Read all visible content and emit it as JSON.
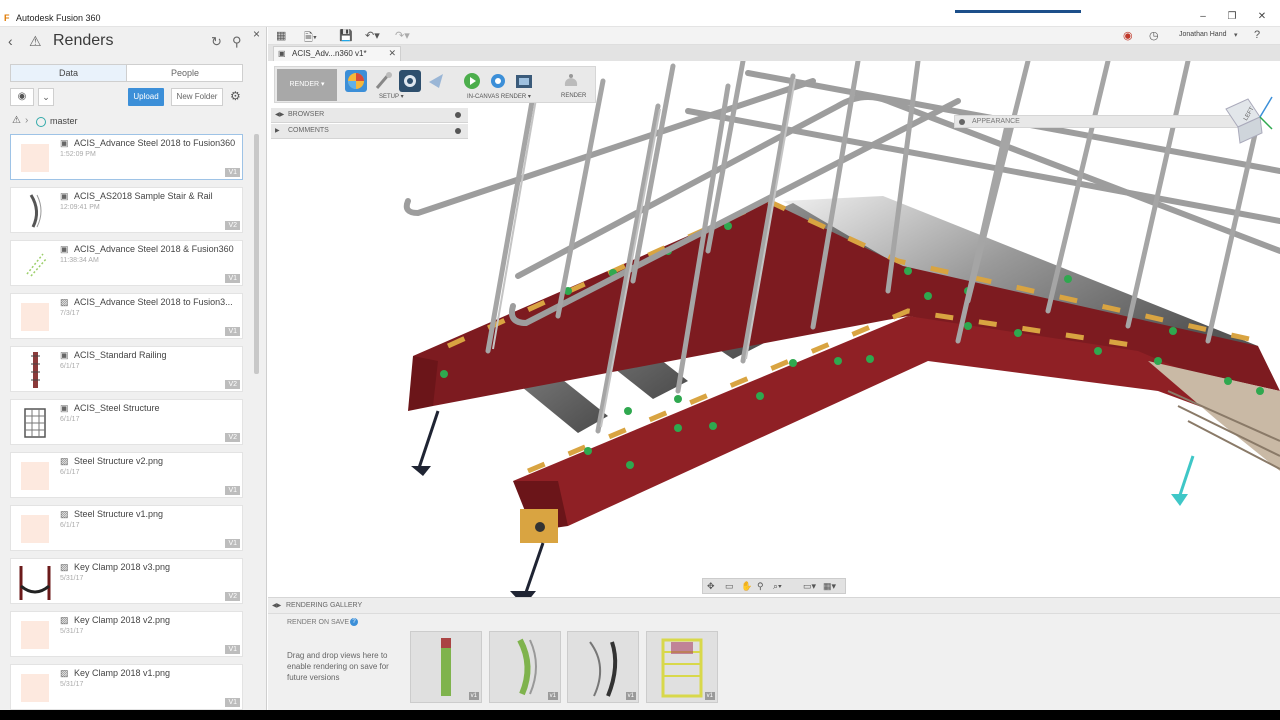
{
  "window": {
    "title": "Autodesk Fusion 360"
  },
  "left_panel": {
    "title": "Renders",
    "tabs": [
      "Data",
      "People"
    ],
    "upload_label": "Upload",
    "new_folder_label": "New Folder",
    "breadcrumb_label": "master",
    "files": [
      {
        "name": "ACIS_Advance Steel 2018 to Fusion360",
        "date": "1:52:09 PM",
        "version": "V1",
        "kind": "design"
      },
      {
        "name": "ACIS_AS2018 Sample Stair & Rail",
        "date": "12:09:41 PM",
        "version": "V2",
        "kind": "design"
      },
      {
        "name": "ACIS_Advance Steel 2018 & Fusion360",
        "date": "11:38:34 AM",
        "version": "V1",
        "kind": "design"
      },
      {
        "name": "ACIS_Advance Steel 2018 to Fusion3...",
        "date": "7/3/17",
        "version": "V1",
        "kind": "image"
      },
      {
        "name": "ACIS_Standard Railing",
        "date": "6/1/17",
        "version": "V2",
        "kind": "design"
      },
      {
        "name": "ACIS_Steel Structure",
        "date": "6/1/17",
        "version": "V2",
        "kind": "design"
      },
      {
        "name": "Steel Structure v2.png",
        "date": "6/1/17",
        "version": "V1",
        "kind": "image"
      },
      {
        "name": "Steel Structure v1.png",
        "date": "6/1/17",
        "version": "V1",
        "kind": "image"
      },
      {
        "name": "Key Clamp 2018 v3.png",
        "date": "5/31/17",
        "version": "V2",
        "kind": "image"
      },
      {
        "name": "Key Clamp 2018 v2.png",
        "date": "5/31/17",
        "version": "V1",
        "kind": "image"
      },
      {
        "name": "Key Clamp 2018 v1.png",
        "date": "5/31/17",
        "version": "V1",
        "kind": "image"
      }
    ]
  },
  "top_toolbar": {
    "user_name": "Jonathan Hand"
  },
  "document_tab": {
    "label": "ACIS_Adv...n360 v1*"
  },
  "ribbon": {
    "render_dropdown": "RENDER ▾",
    "setup_label": "SETUP ▾",
    "in_canvas_label": "IN-CANVAS RENDER ▾",
    "render_label": "RENDER"
  },
  "browser": {
    "browser_label": "BROWSER",
    "comments_label": "COMMENTS"
  },
  "appearance_label": "APPEARANCE",
  "viewcube_label": "LEFT",
  "gallery": {
    "header": "RENDERING GALLERY",
    "render_on_save": "RENDER ON SAVE",
    "hint": "Drag and drop views here to enable rendering on save for future versions",
    "thumbnails": [
      {
        "version": "v1"
      },
      {
        "version": "v1"
      },
      {
        "version": "v1"
      },
      {
        "version": "v1"
      }
    ]
  },
  "colors": {
    "accent_blue": "#3c8fd8",
    "beam_red": "#8b1c20",
    "bolt_green": "#2fa84f",
    "plate_orange": "#d9a441",
    "rail_gray": "#a8a8a8"
  }
}
